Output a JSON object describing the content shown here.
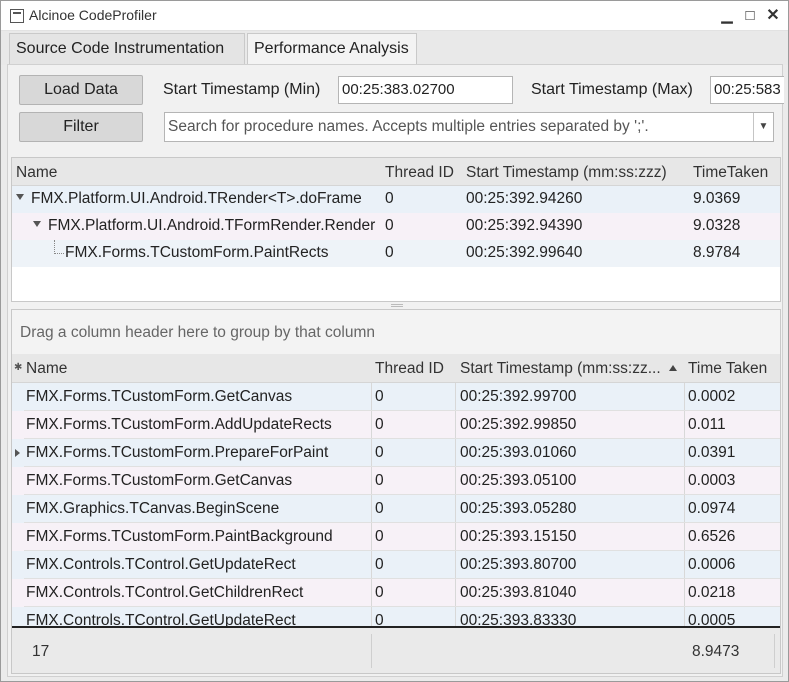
{
  "window": {
    "title": "Alcinoe CodeProfiler",
    "controls": {
      "minimize": "▁",
      "maximize": "□",
      "close": "✕"
    }
  },
  "tabs": [
    "Source Code Instrumentation",
    "Performance Analysis"
  ],
  "toolbar": {
    "load_label": "Load Data",
    "filter_label": "Filter",
    "start_min_label": "Start Timestamp (Min)",
    "start_min_value": "00:25:383.02700",
    "start_max_label": "Start Timestamp (Max)",
    "start_max_value": "00:25:583",
    "search_placeholder": "Search for procedure names. Accepts multiple entries separated by ';'."
  },
  "tree": {
    "columns": [
      "Name",
      "Thread ID",
      "Start Timestamp (mm:ss:zzz)",
      "TimeTaken"
    ],
    "rows": [
      {
        "name": "FMX.Platform.UI.Android.TRender<T>.doFrame",
        "thread": "0",
        "start": "00:25:392.94260",
        "time": "9.0369"
      },
      {
        "name": "FMX.Platform.UI.Android.TFormRender.Render",
        "thread": "0",
        "start": "00:25:392.94390",
        "time": "9.0328"
      },
      {
        "name": "FMX.Forms.TCustomForm.PaintRects",
        "thread": "0",
        "start": "00:25:392.99640",
        "time": "8.9784"
      }
    ]
  },
  "grid": {
    "group_hint": "Drag a column header here to group by that column",
    "columns": [
      "Name",
      "Thread ID",
      "Start Timestamp (mm:ss:zz...",
      "Time Taken"
    ],
    "rows": [
      {
        "name": "FMX.Forms.TCustomForm.GetCanvas",
        "thread": "0",
        "start": "00:25:392.99700",
        "time": "0.0002"
      },
      {
        "name": "FMX.Forms.TCustomForm.AddUpdateRects",
        "thread": "0",
        "start": "00:25:392.99850",
        "time": "0.011"
      },
      {
        "name": "FMX.Forms.TCustomForm.PrepareForPaint",
        "thread": "0",
        "start": "00:25:393.01060",
        "time": "0.0391"
      },
      {
        "name": "FMX.Forms.TCustomForm.GetCanvas",
        "thread": "0",
        "start": "00:25:393.05100",
        "time": "0.0003"
      },
      {
        "name": "FMX.Graphics.TCanvas.BeginScene",
        "thread": "0",
        "start": "00:25:393.05280",
        "time": "0.0974"
      },
      {
        "name": "FMX.Forms.TCustomForm.PaintBackground",
        "thread": "0",
        "start": "00:25:393.15150",
        "time": "0.6526"
      },
      {
        "name": "FMX.Controls.TControl.GetUpdateRect",
        "thread": "0",
        "start": "00:25:393.80700",
        "time": "0.0006"
      },
      {
        "name": "FMX.Controls.TControl.GetChildrenRect",
        "thread": "0",
        "start": "00:25:393.81040",
        "time": "0.0218"
      },
      {
        "name": "FMX.Controls.TControl.GetUpdateRect",
        "thread": "0",
        "start": "00:25:393.83330",
        "time": "0.0005"
      }
    ],
    "footer": {
      "count": "17",
      "total": "8.9473"
    }
  },
  "colors": {
    "row_a": "#eaf1f8",
    "row_b": "#f7f1f7",
    "row_c": "#eef3f8"
  }
}
